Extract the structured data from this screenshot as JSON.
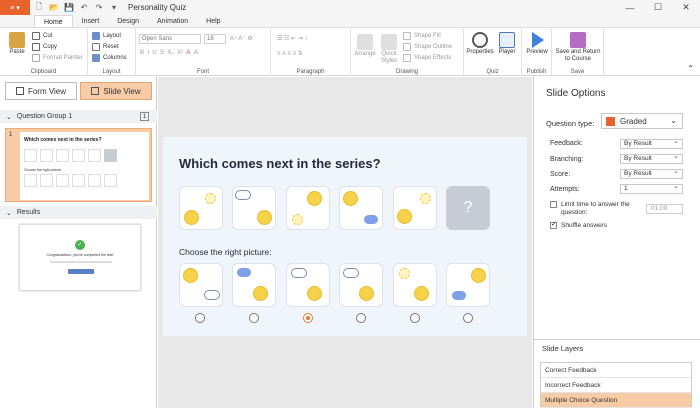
{
  "app": {
    "title": "Personality Quiz",
    "menu_label": "≡ ▾"
  },
  "tabs": [
    "Home",
    "Insert",
    "Design",
    "Animation",
    "Help"
  ],
  "ribbon": {
    "clipboard": {
      "label": "Clipboard",
      "paste": "Paste",
      "cut": "Cut",
      "copy": "Copy",
      "format_painter": "Format Painter"
    },
    "layout": {
      "label": "Layout",
      "layout": "Layout",
      "reset": "Reset",
      "columns": "Columns"
    },
    "font": {
      "label": "Font",
      "font_name": "Open Sans",
      "font_size": "18"
    },
    "paragraph": {
      "label": "Paragraph"
    },
    "drawing": {
      "label": "Drawing",
      "arrange": "Arrange",
      "quick_styles": "Quick Styles",
      "shape_fill": "Shape Fill",
      "shape_outline": "Shape Outline",
      "shape_effects": "Shape Effects"
    },
    "quiz": {
      "label": "Quiz",
      "properties": "Properties",
      "player": "Player"
    },
    "publish": {
      "label": "Publish",
      "preview": "Preview"
    },
    "save": {
      "label": "Save",
      "save_return": "Save and Return to Course"
    }
  },
  "left": {
    "form_view": "Form View",
    "slide_view": "Slide View",
    "group1": "Question Group 1",
    "group1_count": "1",
    "slide_number": "1",
    "thumb_title": "Which comes next in the series?",
    "thumb_sub": "Choose the right picture",
    "results": "Results",
    "results_text": "Congratulations, you've completed the test!"
  },
  "slide": {
    "question": "Which comes next in the series?",
    "subtitle": "Choose the right picture:",
    "question_mark": "?"
  },
  "options": {
    "title": "Slide Options",
    "question_type_label": "Question type:",
    "question_type": "Graded",
    "feedback_label": "Feedback:",
    "feedback": "By Result",
    "branching_label": "Branching:",
    "branching": "By Result",
    "score_label": "Score:",
    "score": "By Result",
    "attempts_label": "Attempts:",
    "attempts": "1",
    "limit_time": "Limit time to answer the question:",
    "time_value": "01:00",
    "shuffle": "Shuffle answers"
  },
  "layers": {
    "title": "Slide Layers",
    "items": [
      "Correct Feedback",
      "Incorrect Feedback",
      "Multiple Choice Question"
    ]
  },
  "colors": {
    "accent": "#e8632b",
    "selection": "#f8cba7"
  }
}
